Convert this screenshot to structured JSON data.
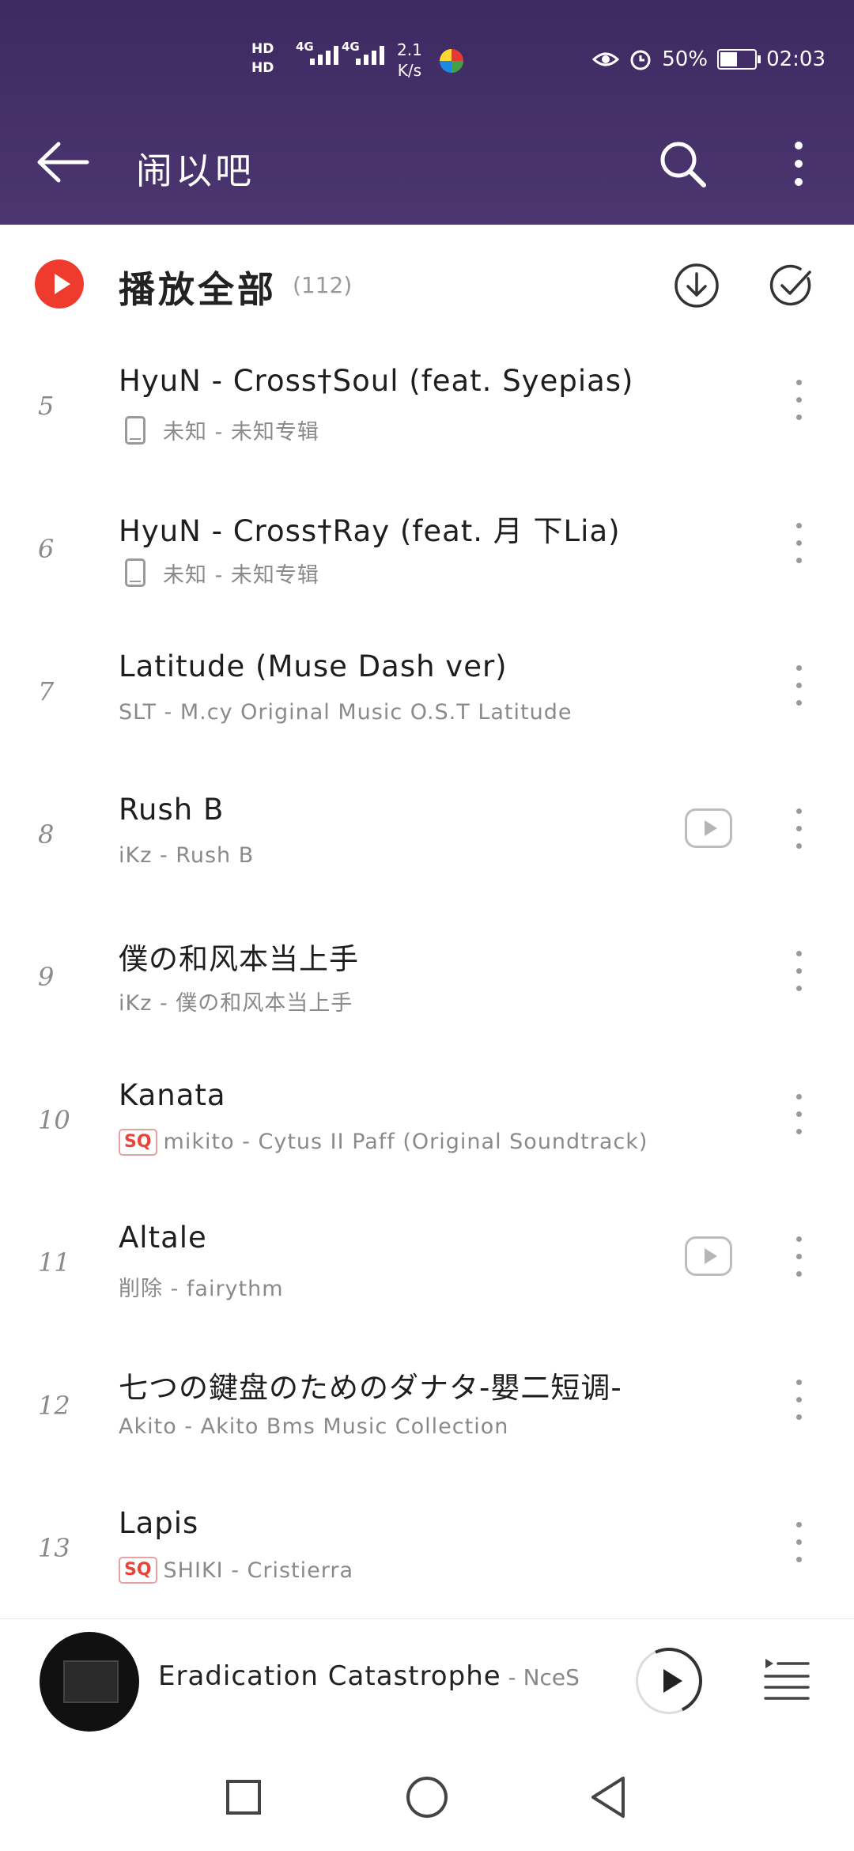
{
  "status_bar": {
    "hd1": "HD",
    "hd2": "HD",
    "net1": "4G",
    "net2": "4G",
    "speed_value": "2.1",
    "speed_unit": "K/s",
    "battery": "50%",
    "time": "02:03",
    "battery_level": 0.5
  },
  "app_bar": {
    "title": "闹以吧",
    "icons": [
      "back-arrow-icon",
      "search-icon",
      "more-vert-icon"
    ]
  },
  "play_all": {
    "label": "播放全部",
    "count": "(112)",
    "accent_color": "#ef3b2d",
    "icons": [
      "play-circle-icon",
      "download-icon",
      "multi-select-check-icon"
    ]
  },
  "songs": [
    {
      "index": "5",
      "title": "HyuN - Cross†Soul (feat. Syepias)",
      "subtitle": "未知 - 未知专辑",
      "badge": "phone",
      "mv": false
    },
    {
      "index": "6",
      "title": "HyuN - Cross†Ray (feat. 月 下Lia)",
      "subtitle": "未知 - 未知专辑",
      "badge": "phone",
      "mv": false
    },
    {
      "index": "7",
      "title": "Latitude (Muse Dash ver)",
      "subtitle": "SLT - M.cy Original Music O.S.T   Latitude",
      "badge": "",
      "mv": false
    },
    {
      "index": "8",
      "title": "Rush B",
      "subtitle": "iKz - Rush B",
      "badge": "",
      "mv": true
    },
    {
      "index": "9",
      "title": "僕の和风本当上手",
      "subtitle": "iKz - 僕の和风本当上手",
      "badge": "",
      "mv": false
    },
    {
      "index": "10",
      "title": "Kanata",
      "subtitle": "mikito - Cytus II Paff (Original Soundtrack)",
      "badge": "SQ",
      "mv": false
    },
    {
      "index": "11",
      "title": "Altale",
      "subtitle": "削除 - fairythm",
      "badge": "",
      "mv": true
    },
    {
      "index": "12",
      "title": "七つの鍵盘のためのダナタ-嬰二短调-",
      "subtitle": "Akito - Akito Bms Music Collection",
      "badge": "",
      "mv": false
    },
    {
      "index": "13",
      "title": "Lapis",
      "subtitle": "SHIKI - Cristierra",
      "badge": "SQ",
      "mv": false
    }
  ],
  "now_playing": {
    "title": "Eradication Catastrophe",
    "separator": " - ",
    "artist": "NceS",
    "progress": 0.3
  },
  "nav_bar": {
    "icons": [
      "recent-apps-icon",
      "home-icon",
      "back-icon"
    ]
  }
}
